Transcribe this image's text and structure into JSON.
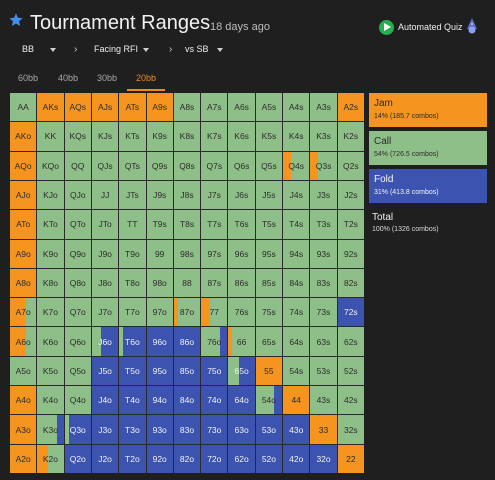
{
  "header": {
    "title": "Tournament Ranges",
    "subtitle": "18 days ago",
    "quiz_label": "Automated Quiz"
  },
  "filters": {
    "position": "BB",
    "action": "Facing RFI",
    "opponent": "vs SB"
  },
  "tabs": [
    "60bb",
    "40bb",
    "30bb",
    "20bb"
  ],
  "active_tab": "20bb",
  "legend": {
    "jam": {
      "label": "Jam",
      "stats": "14% (185.7 combos)",
      "color": "#f5941e"
    },
    "call": {
      "label": "Call",
      "stats": "54% (726.5 combos)",
      "color": "#8fbf88"
    },
    "fold": {
      "label": "Fold",
      "stats": "31% (413.8 combos)",
      "color": "#3c53b0"
    },
    "total": {
      "label": "Total",
      "stats": "100% (1326 combos)"
    }
  },
  "grid": {
    "rows": [
      [
        "AA",
        "AKs",
        "AQs",
        "AJs",
        "ATs",
        "A9s",
        "A8s",
        "A7s",
        "A6s",
        "A5s",
        "A4s",
        "A3s",
        "A2s"
      ],
      [
        "AKo",
        "KK",
        "KQs",
        "KJs",
        "KTs",
        "K9s",
        "K8s",
        "K7s",
        "K6s",
        "K5s",
        "K4s",
        "K3s",
        "K2s"
      ],
      [
        "AQo",
        "KQo",
        "QQ",
        "QJs",
        "QTs",
        "Q9s",
        "Q8s",
        "Q7s",
        "Q6s",
        "Q5s",
        "Q4s",
        "Q3s",
        "Q2s"
      ],
      [
        "AJo",
        "KJo",
        "QJo",
        "JJ",
        "JTs",
        "J9s",
        "J8s",
        "J7s",
        "J6s",
        "J5s",
        "J4s",
        "J3s",
        "J2s"
      ],
      [
        "ATo",
        "KTo",
        "QTo",
        "JTo",
        "TT",
        "T9s",
        "T8s",
        "T7s",
        "T6s",
        "T5s",
        "T4s",
        "T3s",
        "T2s"
      ],
      [
        "A9o",
        "K9o",
        "Q9o",
        "J9o",
        "T9o",
        "99",
        "98s",
        "97s",
        "96s",
        "95s",
        "94s",
        "93s",
        "92s"
      ],
      [
        "A8o",
        "K8o",
        "Q8o",
        "J8o",
        "T8o",
        "98o",
        "88",
        "87s",
        "86s",
        "85s",
        "84s",
        "83s",
        "82s"
      ],
      [
        "A7o",
        "K7o",
        "Q7o",
        "J7o",
        "T7o",
        "97o",
        "87o",
        "77",
        "76s",
        "75s",
        "74s",
        "73s",
        "72s"
      ],
      [
        "A6o",
        "K6o",
        "Q6o",
        "J6o",
        "T6o",
        "96o",
        "86o",
        "76o",
        "66",
        "65s",
        "64s",
        "63s",
        "62s"
      ],
      [
        "A5o",
        "K5o",
        "Q5o",
        "J5o",
        "T5o",
        "95o",
        "85o",
        "75o",
        "65o",
        "55",
        "54s",
        "53s",
        "52s"
      ],
      [
        "A4o",
        "K4o",
        "Q4o",
        "J4o",
        "T4o",
        "94o",
        "84o",
        "74o",
        "64o",
        "54o",
        "44",
        "43s",
        "42s"
      ],
      [
        "A3o",
        "K3o",
        "Q3o",
        "J3o",
        "T3o",
        "93o",
        "83o",
        "73o",
        "63o",
        "53o",
        "43o",
        "33",
        "32s"
      ],
      [
        "A2o",
        "K2o",
        "Q2o",
        "J2o",
        "T2o",
        "92o",
        "82o",
        "72o",
        "62o",
        "52o",
        "42o",
        "32o",
        "22"
      ]
    ],
    "mix": [
      [
        [
          0,
          1,
          0
        ],
        [
          1,
          0,
          0
        ],
        [
          1,
          0,
          0
        ],
        [
          1,
          0,
          0
        ],
        [
          1,
          0,
          0
        ],
        [
          1,
          0,
          0
        ],
        [
          0,
          1,
          0
        ],
        [
          0,
          1,
          0
        ],
        [
          0,
          1,
          0
        ],
        [
          0,
          1,
          0
        ],
        [
          0,
          1,
          0
        ],
        [
          0,
          1,
          0
        ],
        [
          1,
          0,
          0
        ]
      ],
      [
        [
          1,
          0,
          0
        ],
        [
          0,
          1,
          0
        ],
        [
          0,
          1,
          0
        ],
        [
          0,
          1,
          0
        ],
        [
          0,
          1,
          0
        ],
        [
          0,
          1,
          0
        ],
        [
          0,
          1,
          0
        ],
        [
          0,
          1,
          0
        ],
        [
          0,
          1,
          0
        ],
        [
          0,
          1,
          0
        ],
        [
          0,
          1,
          0
        ],
        [
          0,
          1,
          0
        ],
        [
          0,
          1,
          0
        ]
      ],
      [
        [
          1,
          0,
          0
        ],
        [
          0,
          1,
          0
        ],
        [
          0,
          1,
          0
        ],
        [
          0,
          1,
          0
        ],
        [
          0,
          1,
          0
        ],
        [
          0,
          1,
          0
        ],
        [
          0,
          1,
          0
        ],
        [
          0,
          1,
          0
        ],
        [
          0,
          1,
          0
        ],
        [
          0,
          1,
          0
        ],
        [
          0.3,
          0.7,
          0
        ],
        [
          0.3,
          0.7,
          0
        ],
        [
          0,
          1,
          0
        ]
      ],
      [
        [
          1,
          0,
          0
        ],
        [
          0,
          1,
          0
        ],
        [
          0,
          1,
          0
        ],
        [
          0,
          1,
          0
        ],
        [
          0,
          1,
          0
        ],
        [
          0,
          1,
          0
        ],
        [
          0,
          1,
          0
        ],
        [
          0,
          1,
          0
        ],
        [
          0,
          1,
          0
        ],
        [
          0,
          1,
          0
        ],
        [
          0,
          1,
          0
        ],
        [
          0,
          1,
          0
        ],
        [
          0,
          1,
          0
        ]
      ],
      [
        [
          1,
          0,
          0
        ],
        [
          0,
          1,
          0
        ],
        [
          0,
          1,
          0
        ],
        [
          0,
          1,
          0
        ],
        [
          0,
          1,
          0
        ],
        [
          0,
          1,
          0
        ],
        [
          0,
          1,
          0
        ],
        [
          0,
          1,
          0
        ],
        [
          0,
          1,
          0
        ],
        [
          0,
          1,
          0
        ],
        [
          0,
          1,
          0
        ],
        [
          0,
          1,
          0
        ],
        [
          0,
          1,
          0
        ]
      ],
      [
        [
          1,
          0,
          0
        ],
        [
          0,
          1,
          0
        ],
        [
          0,
          1,
          0
        ],
        [
          0,
          1,
          0
        ],
        [
          0,
          1,
          0
        ],
        [
          0,
          1,
          0
        ],
        [
          0,
          1,
          0
        ],
        [
          0,
          1,
          0
        ],
        [
          0,
          1,
          0
        ],
        [
          0,
          1,
          0
        ],
        [
          0,
          1,
          0
        ],
        [
          0,
          1,
          0
        ],
        [
          0,
          1,
          0
        ]
      ],
      [
        [
          1,
          0,
          0
        ],
        [
          0,
          1,
          0
        ],
        [
          0,
          1,
          0
        ],
        [
          0,
          1,
          0
        ],
        [
          0,
          1,
          0
        ],
        [
          0,
          1,
          0
        ],
        [
          0,
          1,
          0
        ],
        [
          0,
          1,
          0
        ],
        [
          0,
          1,
          0
        ],
        [
          0,
          1,
          0
        ],
        [
          0,
          1,
          0
        ],
        [
          0,
          1,
          0
        ],
        [
          0,
          1,
          0
        ]
      ],
      [
        [
          0.6,
          0.4,
          0
        ],
        [
          0,
          1,
          0
        ],
        [
          0,
          1,
          0
        ],
        [
          0,
          1,
          0
        ],
        [
          0,
          1,
          0
        ],
        [
          0,
          1,
          0
        ],
        [
          0.15,
          0.85,
          0
        ],
        [
          0.35,
          0.65,
          0
        ],
        [
          0,
          1,
          0
        ],
        [
          0,
          1,
          0
        ],
        [
          0,
          1,
          0
        ],
        [
          0,
          1,
          0
        ],
        [
          0,
          0,
          1
        ]
      ],
      [
        [
          0.6,
          0.4,
          0
        ],
        [
          0,
          1,
          0
        ],
        [
          0,
          1,
          0
        ],
        [
          0,
          0.35,
          0.65
        ],
        [
          0,
          0.15,
          0.85
        ],
        [
          0,
          0,
          1
        ],
        [
          0,
          0,
          1
        ],
        [
          0,
          0.7,
          0.3
        ],
        [
          0.15,
          0.85,
          0
        ],
        [
          0,
          1,
          0
        ],
        [
          0,
          1,
          0
        ],
        [
          0,
          1,
          0
        ],
        [
          0,
          1,
          0
        ]
      ],
      [
        [
          0,
          1,
          0
        ],
        [
          0,
          1,
          0
        ],
        [
          0,
          1,
          0
        ],
        [
          0,
          0,
          1
        ],
        [
          0,
          0,
          1
        ],
        [
          0,
          0,
          1
        ],
        [
          0,
          0,
          1
        ],
        [
          0,
          0,
          1
        ],
        [
          0,
          0.4,
          0.6
        ],
        [
          1,
          0,
          0
        ],
        [
          0,
          1,
          0
        ],
        [
          0,
          1,
          0
        ],
        [
          0,
          1,
          0
        ]
      ],
      [
        [
          1,
          0,
          0
        ],
        [
          0,
          1,
          0
        ],
        [
          0,
          1,
          0
        ],
        [
          0,
          0,
          1
        ],
        [
          0,
          0,
          1
        ],
        [
          0,
          0,
          1
        ],
        [
          0,
          0,
          1
        ],
        [
          0,
          0,
          1
        ],
        [
          0,
          0,
          1
        ],
        [
          0,
          0.7,
          0.3
        ],
        [
          1,
          0,
          0
        ],
        [
          0,
          1,
          0
        ],
        [
          0,
          1,
          0
        ]
      ],
      [
        [
          1,
          0,
          0
        ],
        [
          0,
          0.75,
          0.25
        ],
        [
          0,
          0.15,
          0.85
        ],
        [
          0,
          0,
          1
        ],
        [
          0,
          0,
          1
        ],
        [
          0,
          0,
          1
        ],
        [
          0,
          0,
          1
        ],
        [
          0,
          0,
          1
        ],
        [
          0,
          0,
          1
        ],
        [
          0,
          0,
          1
        ],
        [
          0,
          0,
          1
        ],
        [
          1,
          0,
          0
        ],
        [
          0,
          1,
          0
        ]
      ],
      [
        [
          1,
          0,
          0
        ],
        [
          0.4,
          0.6,
          0
        ],
        [
          0,
          0,
          1
        ],
        [
          0,
          0,
          1
        ],
        [
          0,
          0,
          1
        ],
        [
          0,
          0,
          1
        ],
        [
          0,
          0,
          1
        ],
        [
          0,
          0,
          1
        ],
        [
          0,
          0,
          1
        ],
        [
          0,
          0,
          1
        ],
        [
          0,
          0,
          1
        ],
        [
          0,
          0,
          1
        ],
        [
          1,
          0,
          0
        ]
      ]
    ]
  }
}
